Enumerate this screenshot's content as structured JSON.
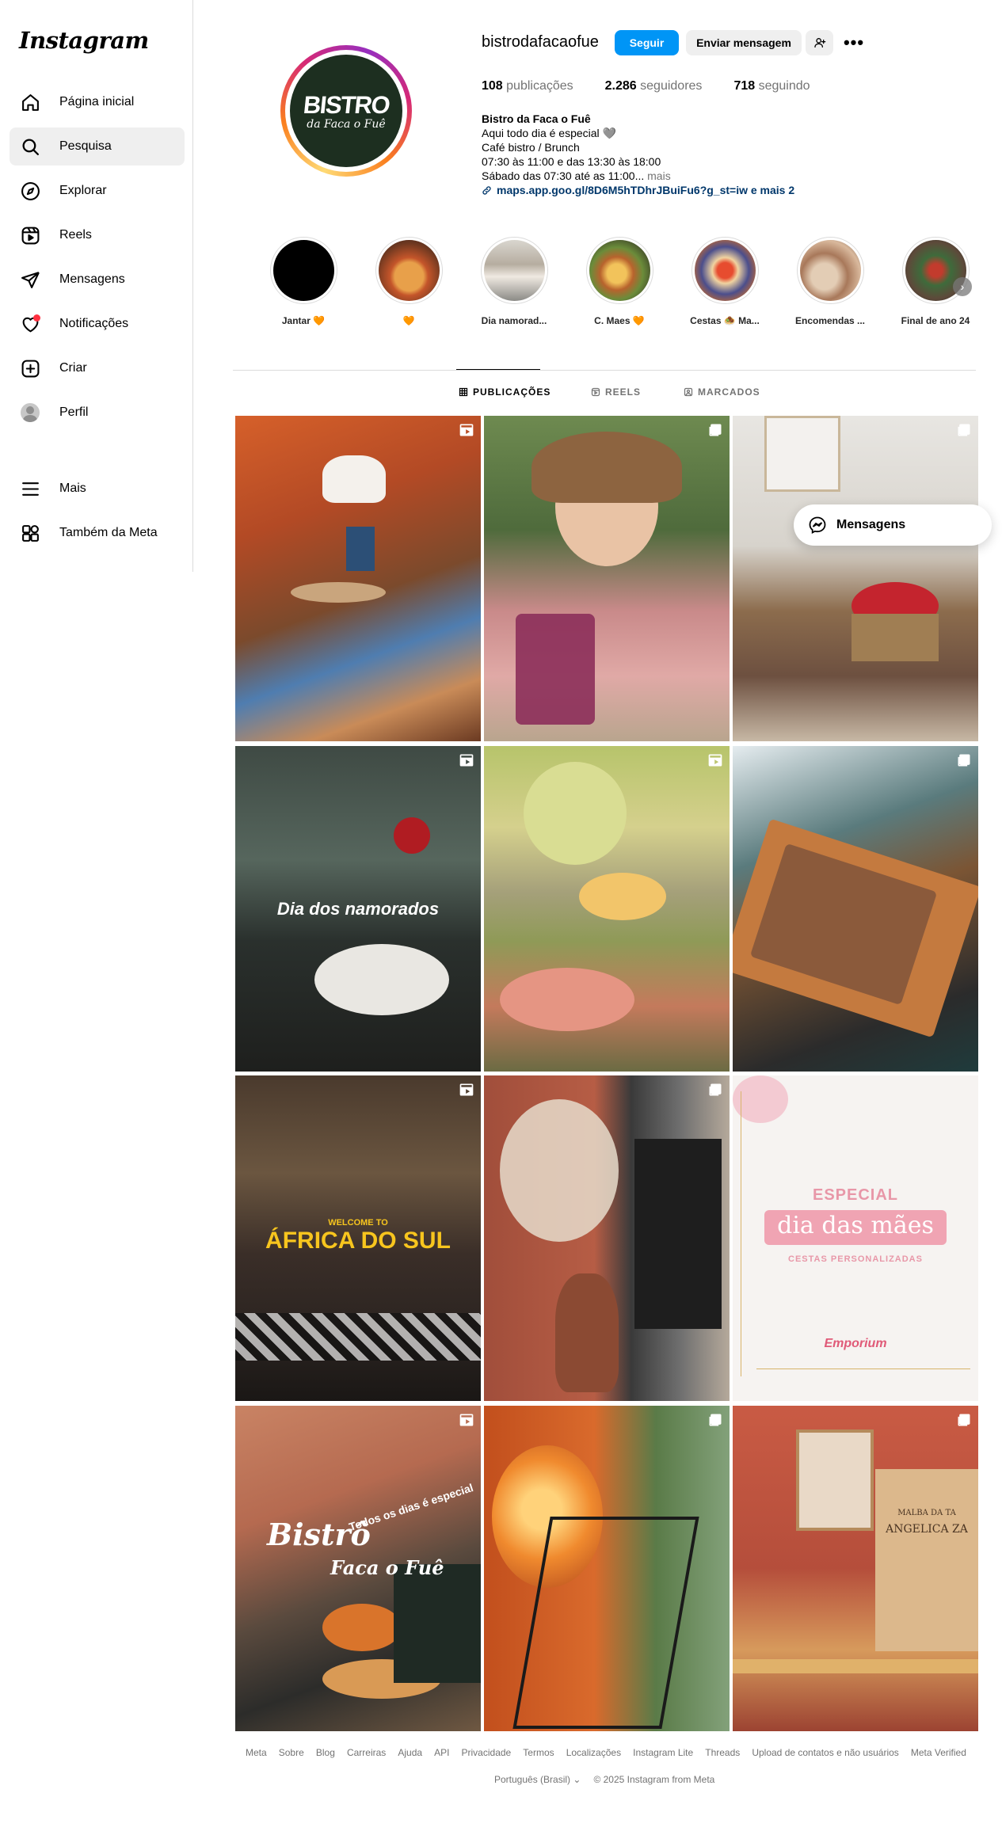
{
  "app": {
    "logo": "Instagram"
  },
  "sidebar": {
    "items": [
      {
        "label": "Página inicial",
        "icon": "home-icon"
      },
      {
        "label": "Pesquisa",
        "icon": "search-icon",
        "active": true
      },
      {
        "label": "Explorar",
        "icon": "compass-icon"
      },
      {
        "label": "Reels",
        "icon": "reels-icon"
      },
      {
        "label": "Mensagens",
        "icon": "send-icon"
      },
      {
        "label": "Notificações",
        "icon": "heart-icon"
      },
      {
        "label": "Criar",
        "icon": "plus-square-icon"
      },
      {
        "label": "Perfil",
        "icon": "avatar"
      }
    ],
    "bottom_items": [
      {
        "label": "Mais",
        "icon": "menu-icon"
      },
      {
        "label": "Também da Meta",
        "icon": "meta-apps-icon"
      }
    ]
  },
  "profile": {
    "username": "bistrodafacaofue",
    "picture_text_1": "BISTRO",
    "picture_text_2": "da Faca o Fuê",
    "follow_label": "Seguir",
    "message_label": "Enviar mensagem",
    "more_label": "•••",
    "stats": {
      "posts_count": "108",
      "posts_label": "publicações",
      "followers_count": "2.286",
      "followers_label": "seguidores",
      "following_count": "718",
      "following_label": "seguindo"
    },
    "bio": {
      "name": "Bistro da Faca o Fuê",
      "line1": "Aqui todo dia é especial 🩶",
      "line2": "Café bistro / Brunch",
      "line3": "07:30 às 11:00 e das 13:30 às 18:00",
      "line4": "Sábado das 07:30 até as 11:00...",
      "more": " mais",
      "link": "maps.app.goo.gl/8D6M5hTDhrJBuiFu6?g_st=iw e mais 2"
    }
  },
  "highlights": [
    {
      "label": "Jantar 🧡"
    },
    {
      "label": "🧡"
    },
    {
      "label": "Dia namorad..."
    },
    {
      "label": "C. Maes 🧡"
    },
    {
      "label": "Cestas 🧆 Ma..."
    },
    {
      "label": "Encomendas ..."
    },
    {
      "label": "Final de ano 24"
    }
  ],
  "tabs": {
    "posts": "PUBLICAÇÕES",
    "reels": "REELS",
    "tagged": "MARCADOS"
  },
  "posts": {
    "p4_text": "Dia dos namorados",
    "p7_small": "WELCOME TO",
    "p7_big": "ÁFRICA DO SUL",
    "p9_top": "ESPECIAL",
    "p9_main": "dia das mães",
    "p9_sub": "CESTAS PERSONALIZADAS",
    "p9_brand": "Emporium",
    "p10_arc": "Todos os dias é especial",
    "p10_main1": "Bistrô",
    "p10_main2": "Faca o Fuê",
    "p12_sign1": "MALBA DA TA",
    "p12_sign2": "ANGELICA ZA"
  },
  "messages_float": {
    "label": "Mensagens"
  },
  "footer": {
    "links": [
      "Meta",
      "Sobre",
      "Blog",
      "Carreiras",
      "Ajuda",
      "API",
      "Privacidade",
      "Termos",
      "Localizações",
      "Instagram Lite",
      "Threads",
      "Upload de contatos e não usuários",
      "Meta Verified"
    ],
    "language": "Português (Brasil)",
    "copyright": "© 2025 Instagram from Meta"
  },
  "colors": {
    "accent": "#0095f6",
    "link": "#00376b",
    "notification": "#ff3040"
  }
}
